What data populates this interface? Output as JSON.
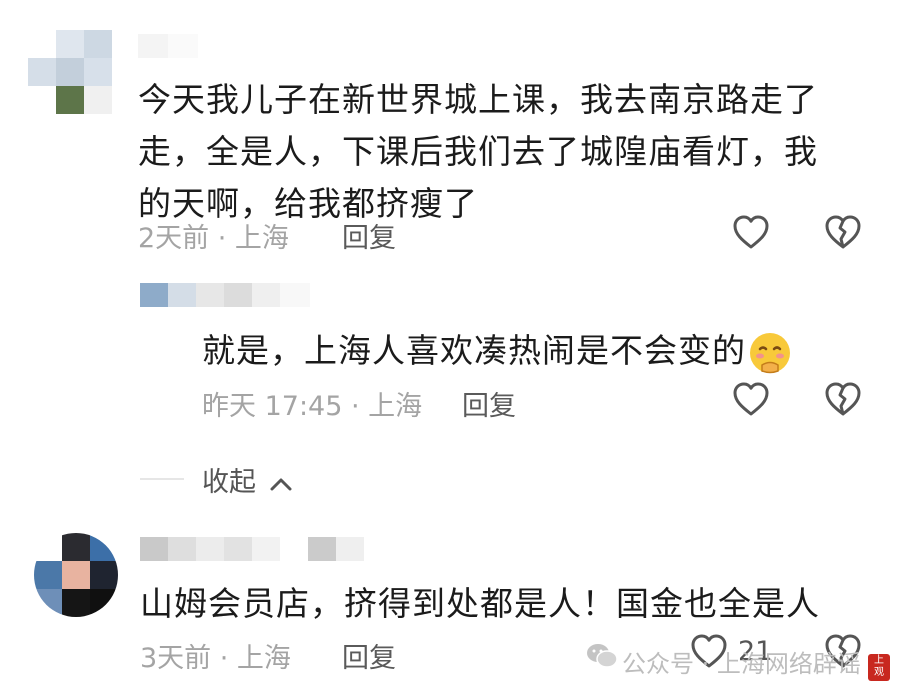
{
  "comments": [
    {
      "text": "今天我儿子在新世界城上课，我去南京路走了走，全是人，下课后我们去了城隍庙看灯，我的天啊，给我都挤瘦了",
      "lines": [
        "今天我儿子在新世界城上课，我去南京路走了",
        "走，全是人，下课后我们去了城隍庙看灯，我",
        "的天啊，给我都挤瘦了"
      ],
      "time": "2天前 · 上海",
      "reply_label": "回复",
      "reply": {
        "text": "就是，上海人喜欢凑热闹是不会变的",
        "emoji": "shy-smile-emoji",
        "time": "昨天 17:45 · 上海",
        "reply_label": "回复"
      },
      "collapse_label": "收起"
    },
    {
      "text": "山姆会员店，挤得到处都是人！国金也全是人",
      "time": "3天前 · 上海",
      "reply_label": "回复",
      "like_count": "21"
    }
  ],
  "watermark": {
    "label": "公众号 · 上海网络辟谣",
    "stamp": "上观"
  },
  "icons": {
    "like": "heart-outline-icon",
    "dislike": "broken-heart-icon",
    "collapse": "chevron-up-icon",
    "wechat": "wechat-icon"
  },
  "colors": {
    "text": "#1b1b1b",
    "meta": "#a4a4a4",
    "stamp": "#c8281f"
  }
}
